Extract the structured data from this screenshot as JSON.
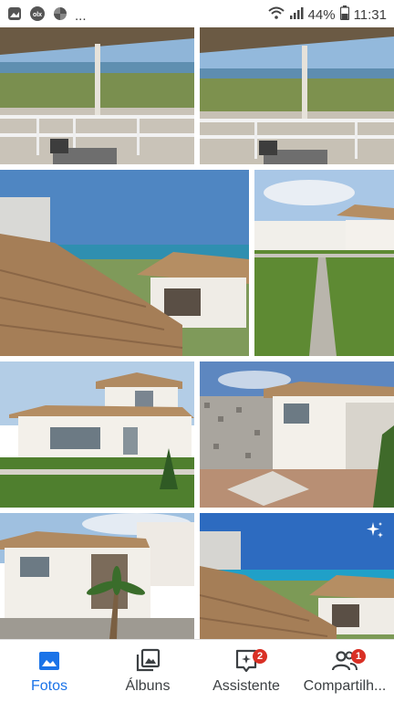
{
  "status_bar": {
    "dots": "...",
    "battery": "44%",
    "time": "11:31"
  },
  "gallery": {
    "photos": [
      {
        "name": "balcony-sea-view"
      },
      {
        "name": "balcony-sea-view-2"
      },
      {
        "name": "rooftops-ocean"
      },
      {
        "name": "lawn-pathway"
      },
      {
        "name": "two-storey-house"
      },
      {
        "name": "courtyard-wall"
      },
      {
        "name": "corner-house-palm"
      },
      {
        "name": "rooftops-ocean-2"
      }
    ]
  },
  "bottom_nav": {
    "items": [
      {
        "label": "Fotos",
        "icon": "photos-icon",
        "active": true
      },
      {
        "label": "Álbuns",
        "icon": "albums-icon",
        "active": false
      },
      {
        "label": "Assistente",
        "icon": "assistant-icon",
        "badge": "2",
        "active": false
      },
      {
        "label": "Compartilh...",
        "icon": "sharing-icon",
        "badge": "1",
        "active": false
      }
    ]
  },
  "colors": {
    "accent": "#1a73e8",
    "badge": "#d93025",
    "text": "#3c4043"
  }
}
